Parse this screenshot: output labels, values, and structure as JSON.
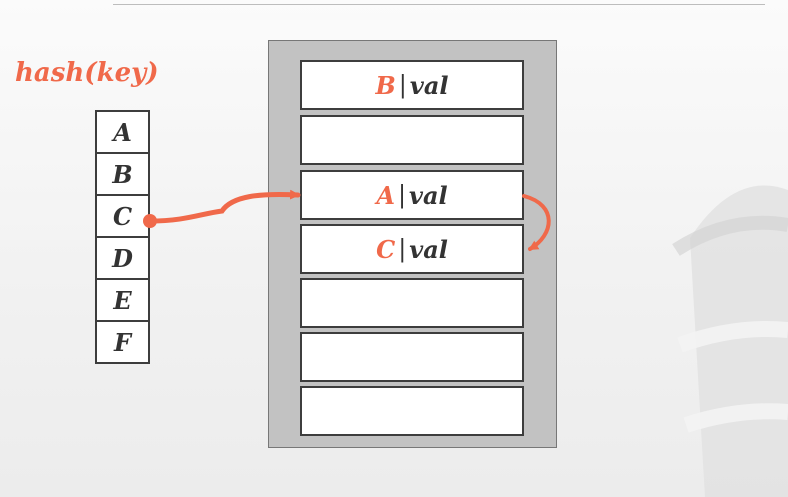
{
  "colors": {
    "accent": "#f0694a",
    "text": "#333333",
    "frame": "#c2c2c2"
  },
  "label": "hash(key)",
  "keys": [
    "A",
    "B",
    "C",
    "D",
    "E",
    "F"
  ],
  "slots": [
    {
      "key": "B",
      "sep": "|",
      "value": "val"
    },
    {
      "key": "",
      "sep": "",
      "value": ""
    },
    {
      "key": "A",
      "sep": "|",
      "value": "val"
    },
    {
      "key": "C",
      "sep": "|",
      "value": "val"
    },
    {
      "key": "",
      "sep": "",
      "value": ""
    },
    {
      "key": "",
      "sep": "",
      "value": ""
    },
    {
      "key": "",
      "sep": "",
      "value": ""
    }
  ]
}
